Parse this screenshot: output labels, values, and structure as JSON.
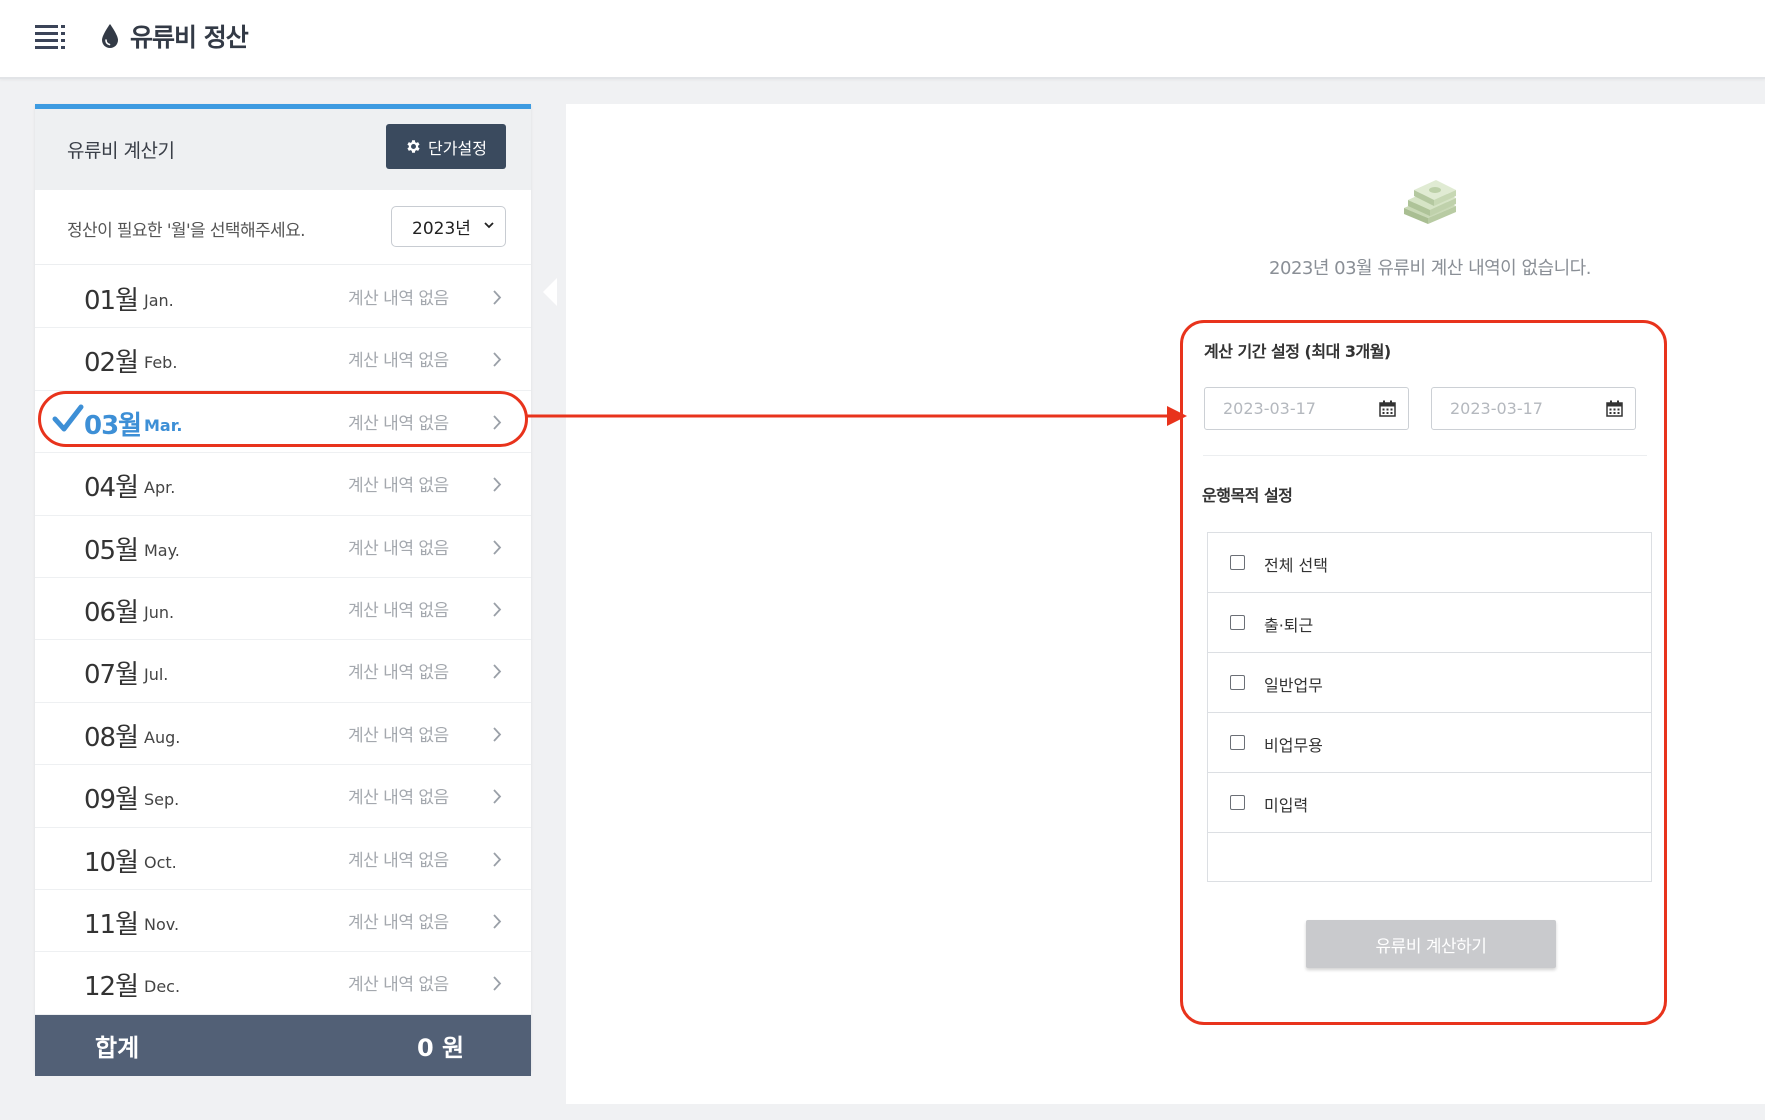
{
  "header": {
    "title": "유류비 정산"
  },
  "sidebar": {
    "title": "유류비 계산기",
    "unit_button": "단가설정",
    "year_prompt": "정산이 필요한 '월'을 선택해주세요.",
    "year_value": "2023년",
    "months": [
      {
        "num": "01월",
        "abbr": "Jan.",
        "status": "계산 내역 없음",
        "selected": false
      },
      {
        "num": "02월",
        "abbr": "Feb.",
        "status": "계산 내역 없음",
        "selected": false
      },
      {
        "num": "03월",
        "abbr": "Mar.",
        "status": "계산 내역 없음",
        "selected": true
      },
      {
        "num": "04월",
        "abbr": "Apr.",
        "status": "계산 내역 없음",
        "selected": false
      },
      {
        "num": "05월",
        "abbr": "May.",
        "status": "계산 내역 없음",
        "selected": false
      },
      {
        "num": "06월",
        "abbr": "Jun.",
        "status": "계산 내역 없음",
        "selected": false
      },
      {
        "num": "07월",
        "abbr": "Jul.",
        "status": "계산 내역 없음",
        "selected": false
      },
      {
        "num": "08월",
        "abbr": "Aug.",
        "status": "계산 내역 없음",
        "selected": false
      },
      {
        "num": "09월",
        "abbr": "Sep.",
        "status": "계산 내역 없음",
        "selected": false
      },
      {
        "num": "10월",
        "abbr": "Oct.",
        "status": "계산 내역 없음",
        "selected": false
      },
      {
        "num": "11월",
        "abbr": "Nov.",
        "status": "계산 내역 없음",
        "selected": false
      },
      {
        "num": "12월",
        "abbr": "Dec.",
        "status": "계산 내역 없음",
        "selected": false
      }
    ],
    "total_label": "합계",
    "total_value": "0 원"
  },
  "main": {
    "empty_message": "2023년 03월 유류비 계산 내역이 없습니다.",
    "period_title": "계산 기간 설정 (최대 3개월)",
    "start_date": "2023-03-17",
    "end_date": "2023-03-17",
    "purpose_title": "운행목적 설정",
    "purposes": [
      {
        "label": "전체 선택",
        "checked": false
      },
      {
        "label": "출·퇴근",
        "checked": false
      },
      {
        "label": "일반업무",
        "checked": false
      },
      {
        "label": "비업무용",
        "checked": false
      },
      {
        "label": "미입력",
        "checked": false
      }
    ],
    "calc_button": "유류비 계산하기"
  },
  "colors": {
    "accent_blue": "#3d9be1",
    "selected_text": "#3d8fd6",
    "annotation_red": "#e8331c",
    "total_bar": "#526076",
    "header_button": "#3a4a5e"
  }
}
